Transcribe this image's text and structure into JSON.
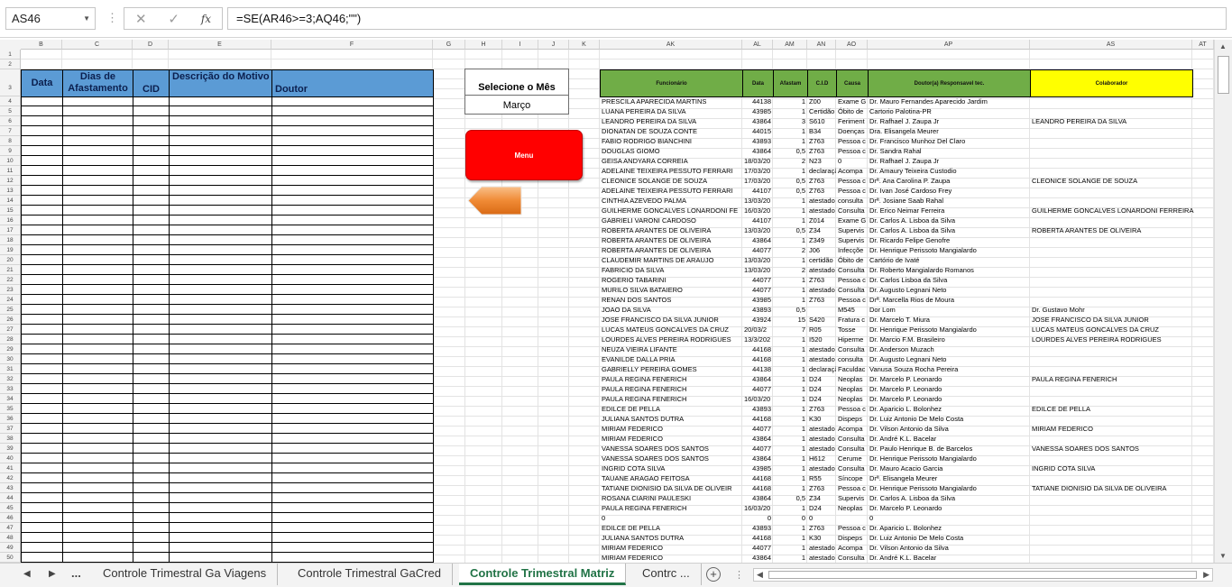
{
  "formula_bar": {
    "name_box": "AS46",
    "formula": "=SE(AR46>=3;AQ46;\"\")",
    "cancel_icon": "x-icon",
    "enter_icon": "check-icon",
    "fx_label": "fx"
  },
  "columns": [
    "B",
    "C",
    "D",
    "E",
    "F",
    "G",
    "H",
    "I",
    "J",
    "K",
    "AK",
    "AL",
    "AM",
    "AN",
    "AO",
    "AP",
    "AS",
    "AT"
  ],
  "rows": [
    "1",
    "2",
    "3",
    "4",
    "5",
    "6",
    "7",
    "8",
    "9",
    "10",
    "11",
    "12",
    "13",
    "14",
    "15",
    "16",
    "17",
    "18",
    "19",
    "20",
    "21",
    "22",
    "23",
    "24",
    "25",
    "26",
    "27",
    "28",
    "29",
    "30",
    "31",
    "32",
    "33",
    "34",
    "35",
    "36",
    "37",
    "38",
    "39",
    "40",
    "41",
    "42",
    "43",
    "44",
    "45",
    "46",
    "47",
    "48",
    "49",
    "50"
  ],
  "left_table": {
    "headers": [
      "Data",
      "Dias de Afastamento",
      "CID",
      "Descrição do Motivo",
      "Doutor"
    ]
  },
  "month_selector": {
    "title": "Selecione o Mês",
    "value": "Março"
  },
  "menu_button": "Menu",
  "right_table": {
    "headers": [
      "Funcionário",
      "Data",
      "Afastam",
      "C.I.D",
      "Causa",
      "Doutor(a) Responsavel tec.",
      "Colaborador"
    ],
    "header_colors": {
      "green": "#70ad47",
      "yellow": "#ffff00"
    },
    "rows": [
      [
        "PRESCILA APARECIDA MARTINS",
        "44138",
        "1",
        "Z00",
        "Exame G",
        "Dr. Mauro Fernandes Aparecido Jardim",
        ""
      ],
      [
        "LUANA PEREIRA DA SILVA",
        "43985",
        "1",
        "Certidão",
        "Óbito de",
        "Cartorio Palotina-PR",
        ""
      ],
      [
        "LEANDRO PEREIRA DA SILVA",
        "43864",
        "3",
        "S610",
        "Feriment",
        "Dr. Rafhael J. Zaupa Jr",
        "LEANDRO PEREIRA DA SILVA"
      ],
      [
        "DIONATAN DE SOUZA CONTE",
        "44015",
        "1",
        "B34",
        "Doenças",
        "Dra. Elisangela Meurer",
        ""
      ],
      [
        "FABIO RODRIGO BIANCHINI",
        "43893",
        "1",
        "Z763",
        "Pessoa c",
        "Dr. Francisco Munhoz Del Claro",
        ""
      ],
      [
        "DOUGLAS GIOMO",
        "43864",
        "0,5",
        "Z763",
        "Pessoa c",
        "Dr. Sandra Rahal",
        ""
      ],
      [
        "GEISA ANDYARA CORREIA",
        "18/03/20",
        "2",
        "N23",
        "0",
        "Dr. Rafhael J. Zaupa Jr",
        ""
      ],
      [
        "ADELAINE TEIXEIRA PESSUTO FERRARI",
        "17/03/20",
        "1",
        "declaraçã",
        "Acompa",
        "Dr. Amaury Teixeira Custodio",
        ""
      ],
      [
        "CLEONICE SOLANGE DE SOUZA",
        "17/03/20",
        "0,5",
        "Z763",
        "Pessoa c",
        "Drª. Ana Carolina P. Zaupa",
        "CLEONICE SOLANGE DE SOUZA"
      ],
      [
        "ADELAINE TEIXEIRA PESSUTO FERRARI",
        "44107",
        "0,5",
        "Z763",
        "Pessoa c",
        "Dr. Ivan José Cardoso Frey",
        ""
      ],
      [
        "CINTHIA AZEVEDO PALMA",
        "13/03/20",
        "1",
        "atestado",
        "consulta",
        "Drª. Josiane Saab Rahal",
        ""
      ],
      [
        "GUILHERME GONCALVES LONARDONI FE",
        "16/03/20",
        "1",
        "atestado",
        "Consulta",
        "Dr. Erico Neimar Ferreira",
        "GUILHERME GONCALVES LONARDONI FERREIRA"
      ],
      [
        "GABRIELI VARONI CARDOSO",
        "44107",
        "1",
        "Z014",
        "Exame G",
        "Dr. Carlos A. Lisboa da Silva",
        ""
      ],
      [
        "ROBERTA ARANTES DE OLIVEIRA",
        "13/03/20",
        "0,5",
        "Z34",
        "Supervis",
        "Dr. Carlos A. Lisboa da Silva",
        "ROBERTA ARANTES DE OLIVEIRA"
      ],
      [
        "ROBERTA ARANTES DE OLIVEIRA",
        "43864",
        "1",
        "Z349",
        "Supervis",
        "Dr. Ricardo Felipe Genofre",
        ""
      ],
      [
        "ROBERTA ARANTES DE OLIVEIRA",
        "44077",
        "2",
        "J06",
        "Infecçõe",
        "Dr. Henrique Perissoto Mangialardo",
        ""
      ],
      [
        "CLAUDEMIR MARTINS DE ARAUJO",
        "13/03/20",
        "1",
        "certidão",
        "Óbito de",
        "Cartório de Ivaté",
        ""
      ],
      [
        "FABRICIO DA SILVA",
        "13/03/20",
        "2",
        "atestado",
        "Consulta",
        "Dr. Roberto Mangialardo Romanos",
        ""
      ],
      [
        "ROGERIO TABARINI",
        "44077",
        "1",
        "Z763",
        "Pessoa c",
        "Dr. Carlos Lisboa da Silva",
        ""
      ],
      [
        "MURILO SILVA BATAIERO",
        "44077",
        "1",
        "atestado",
        "Consulta",
        "Dr. Augusto Legnani Neto",
        ""
      ],
      [
        "RENAN DOS SANTOS",
        "43985",
        "1",
        "Z763",
        "Pessoa c",
        "Drª. Marcella Rios de Moura",
        ""
      ],
      [
        "JOAO DA SILVA",
        "43893",
        "0,5",
        "",
        "M545",
        "Dor Lom",
        "Dr. Gustavo Mohr"
      ],
      [
        "JOSE FRANCISCO DA SILVA JUNIOR",
        "43924",
        "15",
        "S420",
        "Fratura c",
        "Dr. Marcelo T. Miura",
        "JOSE FRANCISCO DA SILVA JUNIOR"
      ],
      [
        "LUCAS MATEUS GONCALVES DA CRUZ",
        "20/03/2",
        "7",
        "R05",
        "Tosse",
        "Dr. Henrique Perissoto Mangialardo",
        "LUCAS MATEUS GONCALVES DA CRUZ"
      ],
      [
        "LOURDES ALVES PEREIRA RODRIGUES",
        "13/3/202",
        "1",
        "I520",
        "Hiperme",
        "Dr. Marcio F.M. Brasileiro",
        "LOURDES ALVES PEREIRA RODRIGUES"
      ],
      [
        "NEUZA VIEIRA LIFANTE",
        "44168",
        "1",
        "atestado",
        "Consulta",
        "Dr. Anderson Muzach",
        ""
      ],
      [
        "EVANILDE DALLA PRIA",
        "44168",
        "1",
        "atestado",
        "consulta",
        "Dr. Augusto Legnani Neto",
        ""
      ],
      [
        "GABRIELLY PEREIRA GOMES",
        "44138",
        "1",
        "declaraçã",
        "Faculdac",
        "Vanusa Souza Rocha Pereira",
        ""
      ],
      [
        "PAULA REGINA FENERICH",
        "43864",
        "1",
        "D24",
        "Neoplas",
        "Dr. Marcelo P. Leonardo",
        "PAULA REGINA FENERICH"
      ],
      [
        "PAULA REGINA FENERICH",
        "44077",
        "1",
        "D24",
        "Neoplas",
        "Dr. Marcelo P. Leonardo",
        ""
      ],
      [
        "PAULA REGINA FENERICH",
        "16/03/20",
        "1",
        "D24",
        "Neoplas",
        "Dr. Marcelo P. Leonardo",
        ""
      ],
      [
        "EDILCE DE PELLA",
        "43893",
        "1",
        "Z763",
        "Pessoa c",
        "Dr. Aparicio L. Bolonhez",
        "EDILCE DE PELLA"
      ],
      [
        "JULIANA SANTOS DUTRA",
        "44168",
        "1",
        "K30",
        "Dispeps",
        "Dr. Luiz Antonio De Melo Costa",
        ""
      ],
      [
        "MIRIAM FEDERICO",
        "44077",
        "1",
        "atestado",
        "Acompa",
        "Dr. Vilson Antonio da Silva",
        "MIRIAM FEDERICO"
      ],
      [
        "MIRIAM FEDERICO",
        "43864",
        "1",
        "atestado",
        "Consulta",
        "Dr. André K.L. Bacelar",
        ""
      ],
      [
        "VANESSA SOARES DOS SANTOS",
        "44077",
        "1",
        "atestado",
        "Consulta",
        "Dr. Paulo Henrique B. de Barcelos",
        "VANESSA SOARES DOS SANTOS"
      ],
      [
        "VANESSA SOARES DOS SANTOS",
        "43864",
        "1",
        "H612",
        "Cerume",
        "Dr. Henrique Perissoto Mangialardo",
        ""
      ],
      [
        "INGRID COTA SILVA",
        "43985",
        "1",
        "atestado",
        "Consulta",
        "Dr. Mauro Acacio Garcia",
        "INGRID COTA SILVA"
      ],
      [
        "TAUANE ARAGAO FEITOSA",
        "44168",
        "1",
        "R55",
        "Síncope",
        "Drª. Elisangela Meurer",
        ""
      ],
      [
        "TATIANE DIONISIO DA SILVA DE OLIVEIR",
        "44168",
        "1",
        "Z763",
        "Pessoa c",
        "Dr. Henrique Perissoto Mangialardo",
        "TATIANE DIONISIO DA SILVA DE OLIVEIRA"
      ],
      [
        "ROSANA CIARINI PAULESKI",
        "43864",
        "0,5",
        "Z34",
        "Supervis",
        "Dr. Carlos A. Lisboa da Silva",
        ""
      ],
      [
        "PAULA REGINA FENERICH",
        "16/03/20",
        "1",
        "D24",
        "Neoplas",
        "Dr. Marcelo P. Leonardo",
        ""
      ],
      [
        "0",
        "0",
        "0",
        "0",
        "",
        "0",
        ""
      ],
      [
        "EDILCE DE PELLA",
        "43893",
        "1",
        "Z763",
        "Pessoa c",
        "Dr. Aparicio L. Bolonhez",
        ""
      ],
      [
        "JULIANA SANTOS DUTRA",
        "44168",
        "1",
        "K30",
        "Dispeps",
        "Dr. Luiz Antonio De Melo Costa",
        ""
      ],
      [
        "MIRIAM FEDERICO",
        "44077",
        "1",
        "atestado",
        "Acompa",
        "Dr. Vilson Antonio da Silva",
        ""
      ],
      [
        "MIRIAM FEDERICO",
        "43864",
        "1",
        "atestado",
        "Consulta",
        "Dr. André K.L. Bacelar",
        ""
      ]
    ]
  },
  "sheet_tabs": {
    "nav_prev": "◀",
    "nav_next": "▶",
    "more": "...",
    "tabs": [
      "Controle Trimestral Ga Viagens",
      "Controle Trimestral GaCred",
      "Controle Trimestral Matriz",
      "Contrc ..."
    ],
    "active_index": 2,
    "add_label": "+"
  }
}
